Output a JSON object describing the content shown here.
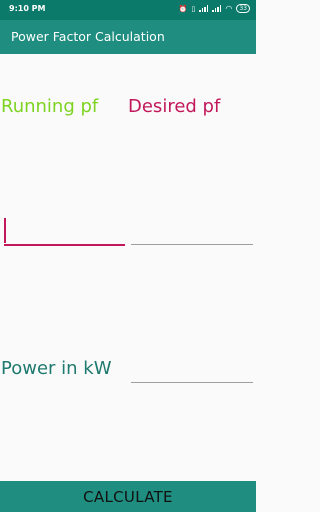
{
  "status_bar": {
    "time": "9:10 PM",
    "battery": "33"
  },
  "app_bar": {
    "title": "Power Factor Calculation"
  },
  "form": {
    "running_pf_label": "Running pf",
    "desired_pf_label": "Desired pf",
    "power_label": "Power in kW",
    "running_pf_value": "",
    "desired_pf_value": "",
    "power_value": ""
  },
  "button": {
    "calculate_label": "CALCULATE"
  },
  "colors": {
    "status_bar": "#0b7a6b",
    "app_bar": "#1f8d7f",
    "running_label": "#7ed321",
    "desired_label": "#c2185b",
    "power_label": "#1e7a6e",
    "focused_underline": "#c2185b",
    "underline": "#9e9e9e"
  }
}
